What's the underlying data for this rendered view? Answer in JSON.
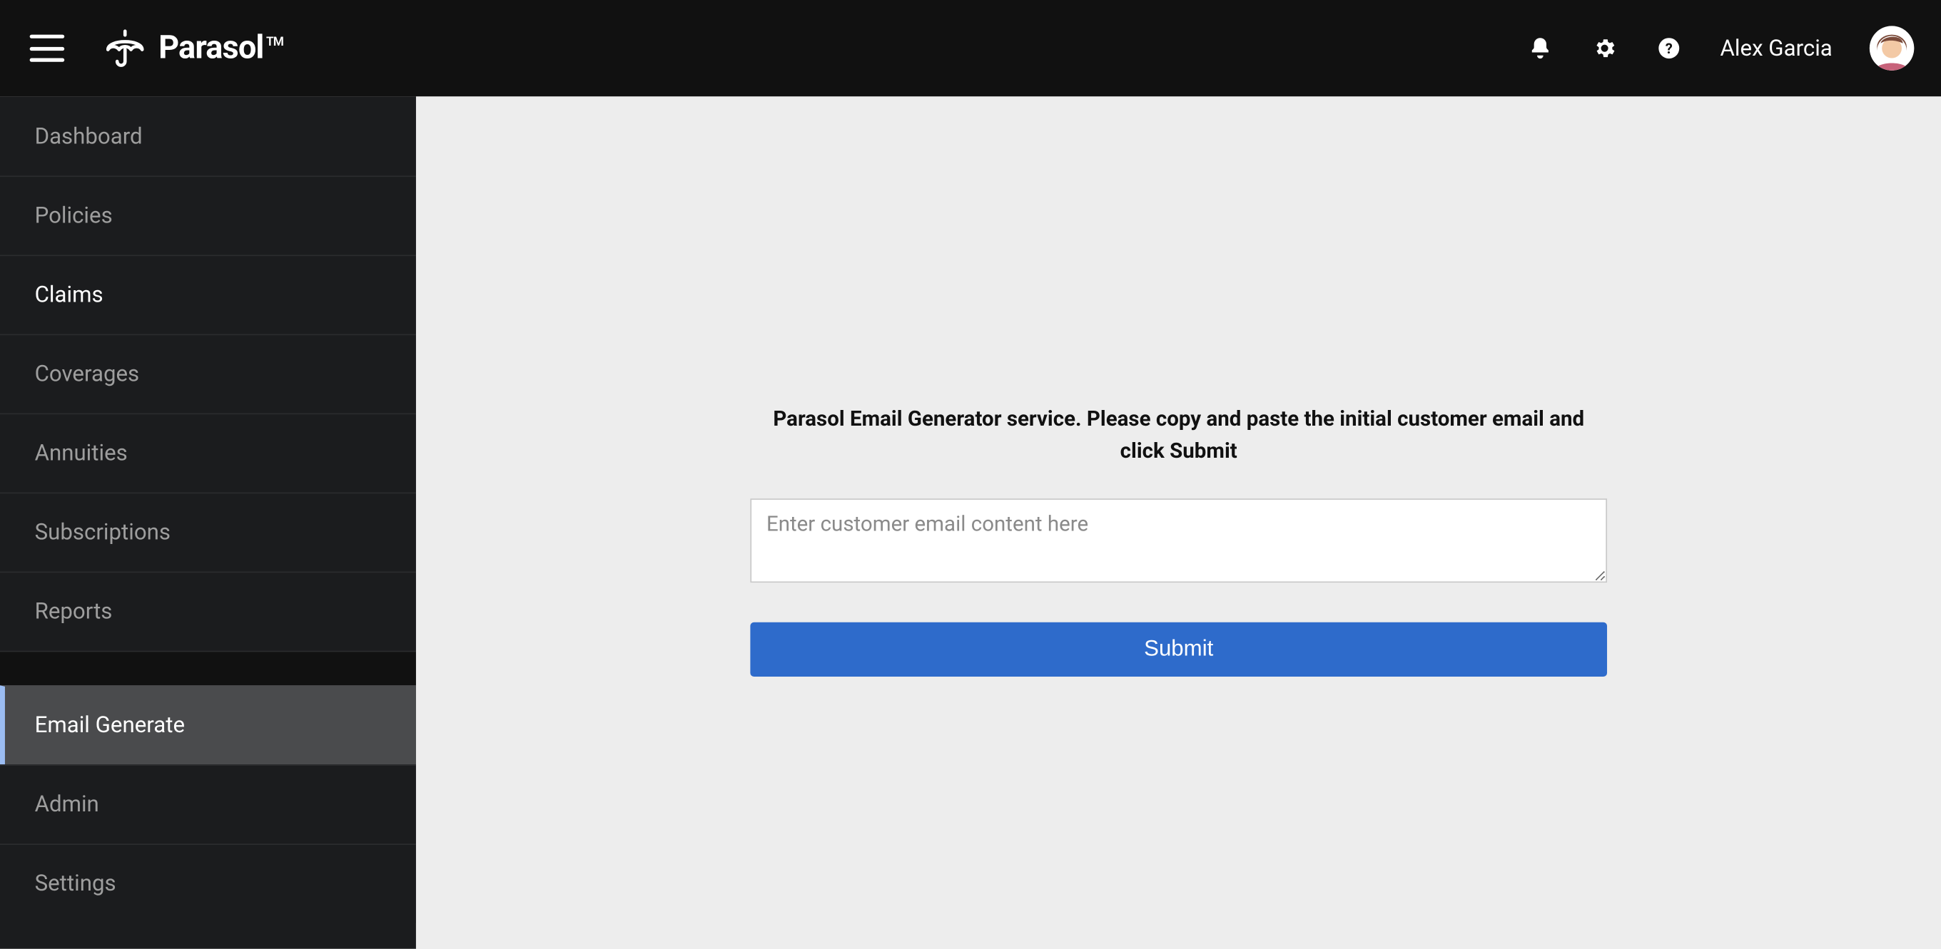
{
  "header": {
    "brand_name": "Parasol",
    "brand_tm": "TM",
    "user_name": "Alex Garcia"
  },
  "sidebar": {
    "items": [
      {
        "label": "Dashboard",
        "state": "default"
      },
      {
        "label": "Policies",
        "state": "default"
      },
      {
        "label": "Claims",
        "state": "emphasis"
      },
      {
        "label": "Coverages",
        "state": "default"
      },
      {
        "label": "Annuities",
        "state": "default"
      },
      {
        "label": "Subscriptions",
        "state": "default"
      },
      {
        "label": "Reports",
        "state": "default"
      }
    ],
    "secondary": [
      {
        "label": "Email Generate",
        "state": "current"
      },
      {
        "label": "Admin",
        "state": "default"
      },
      {
        "label": "Settings",
        "state": "default"
      }
    ]
  },
  "main": {
    "instructions": "Parasol Email Generator service. Please copy and paste the initial customer email and click Submit",
    "textarea_placeholder": "Enter customer email content here",
    "textarea_value": "",
    "submit_label": "Submit"
  },
  "icons": {
    "hamburger": "menu-icon",
    "bell": "bell-icon",
    "gear": "gear-icon",
    "help": "help-icon",
    "umbrella": "umbrella-icon"
  },
  "colors": {
    "topbar_bg": "#111111",
    "sidebar_bg": "#1b1c1e",
    "sidebar_active_bg": "#4a4b4d",
    "sidebar_active_border": "#9bbcf2",
    "primary_button": "#2e6bcb",
    "page_bg": "#ededed"
  }
}
